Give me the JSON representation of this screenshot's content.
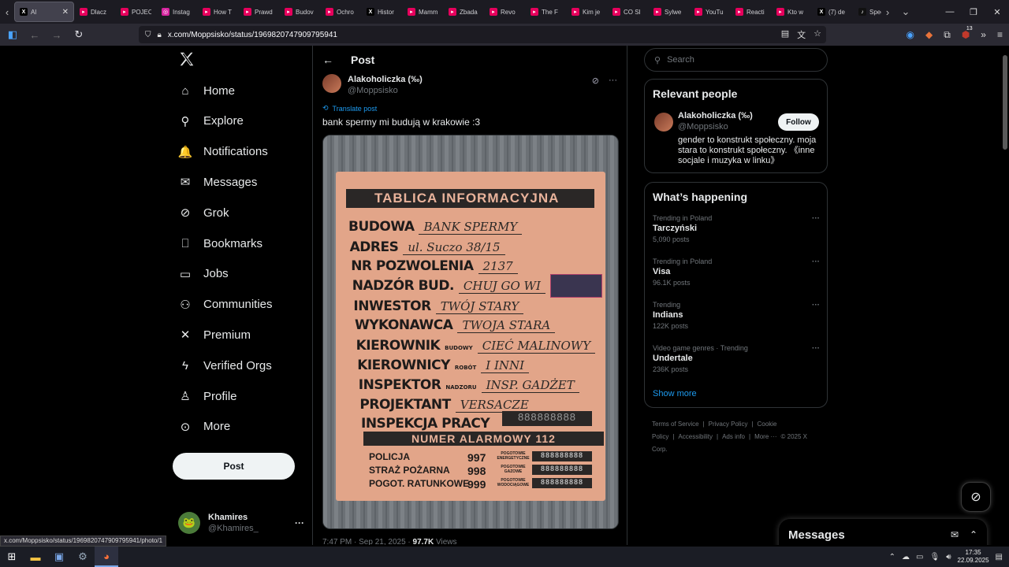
{
  "browser": {
    "tabs": [
      {
        "label": "Al",
        "color": "#000000",
        "glyph": "X",
        "active": true
      },
      {
        "label": "Dlacz",
        "color": "#e6005c",
        "glyph": "▸"
      },
      {
        "label": "POJEC",
        "color": "#e6005c",
        "glyph": "▸"
      },
      {
        "label": "Instag",
        "color": "#d6249f",
        "glyph": "◎"
      },
      {
        "label": "How T",
        "color": "#e6005c",
        "glyph": "▸"
      },
      {
        "label": "Prawd",
        "color": "#e6005c",
        "glyph": "▸"
      },
      {
        "label": "Budov",
        "color": "#e6005c",
        "glyph": "▸"
      },
      {
        "label": "Ochro",
        "color": "#e6005c",
        "glyph": "▸"
      },
      {
        "label": "Histor",
        "color": "#000000",
        "glyph": "X"
      },
      {
        "label": "Mamm",
        "color": "#e6005c",
        "glyph": "▸"
      },
      {
        "label": "Zbada",
        "color": "#e6005c",
        "glyph": "▸"
      },
      {
        "label": "Revo",
        "color": "#e6005c",
        "glyph": "▸"
      },
      {
        "label": "The F",
        "color": "#e6005c",
        "glyph": "▸"
      },
      {
        "label": "Kim je",
        "color": "#e6005c",
        "glyph": "▸"
      },
      {
        "label": "CO SI",
        "color": "#e6005c",
        "glyph": "▸"
      },
      {
        "label": "Sylwe",
        "color": "#e6005c",
        "glyph": "▸"
      },
      {
        "label": "YouTu",
        "color": "#e6005c",
        "glyph": "▸"
      },
      {
        "label": "Reacti",
        "color": "#e6005c",
        "glyph": "▸"
      },
      {
        "label": "Kto w",
        "color": "#e6005c",
        "glyph": "▸"
      },
      {
        "label": "(7) de",
        "color": "#000000",
        "glyph": "X"
      },
      {
        "label": "Spee",
        "color": "#111111",
        "glyph": "♪"
      }
    ],
    "url": "x.com/Moppsisko/status/1969820747909795941",
    "status_url": "x.com/Moppsisko/status/1969820747909795941/photo/1",
    "extension_badge": "13"
  },
  "nav": {
    "items": [
      {
        "label": "Home",
        "icon": "home-icon",
        "glyph": "⌂"
      },
      {
        "label": "Explore",
        "icon": "search-icon",
        "glyph": "⚲"
      },
      {
        "label": "Notifications",
        "icon": "bell-icon",
        "glyph": "🔔"
      },
      {
        "label": "Messages",
        "icon": "envelope-icon",
        "glyph": "✉"
      },
      {
        "label": "Grok",
        "icon": "grok-icon",
        "glyph": "⊘"
      },
      {
        "label": "Bookmarks",
        "icon": "bookmark-icon",
        "glyph": "⎕"
      },
      {
        "label": "Jobs",
        "icon": "briefcase-icon",
        "glyph": "▭"
      },
      {
        "label": "Communities",
        "icon": "people-icon",
        "glyph": "⚇"
      },
      {
        "label": "Premium",
        "icon": "x-icon",
        "glyph": "✕"
      },
      {
        "label": "Verified Orgs",
        "icon": "lightning-icon",
        "glyph": "ϟ"
      },
      {
        "label": "Profile",
        "icon": "person-icon",
        "glyph": "♙"
      },
      {
        "label": "More",
        "icon": "more-circle-icon",
        "glyph": "⊙"
      }
    ],
    "post_label": "Post",
    "account": {
      "name": "Khamires",
      "handle": "@Khamires_"
    }
  },
  "post": {
    "header_title": "Post",
    "author": {
      "name": "Alakoholiczka (‰)",
      "handle": "@Moppsisko"
    },
    "translate_label": "Translate post",
    "text": "bank spermy mi budują w krakowie :3",
    "meta": {
      "time": "7:47 PM · Sep 21, 2025 · ",
      "views_count": "97.7K",
      "views_label": " Views"
    },
    "sign": {
      "header": "TABLICA INFORMACYJNA",
      "rows": [
        {
          "label": "BUDOWA",
          "sub": "",
          "value": "BANK SPERMY"
        },
        {
          "label": "ADRES",
          "sub": "",
          "value": "ul. Suczo 38/15"
        },
        {
          "label": "NR POZWOLENIA",
          "sub": "",
          "value": "2137"
        },
        {
          "label": "NADZÓR BUD.",
          "sub": "",
          "value": "CHUJ GO WI"
        },
        {
          "label": "INWESTOR",
          "sub": "",
          "value": "TWÓJ STARY"
        },
        {
          "label": "WYKONAWCA",
          "sub": "",
          "value": "TWOJA STARA"
        },
        {
          "label": "KIEROWNIK",
          "sub": "BUDOWY",
          "value": "CIEĆ MALINOWY"
        },
        {
          "label": "KIEROWNICY",
          "sub": "ROBÓT",
          "value": "I INNI"
        },
        {
          "label": "INSPEKTOR",
          "sub": "NADZORU",
          "value": "INSP. GADŻET"
        },
        {
          "label": "PROJEKTANT",
          "sub": "",
          "value": "VERSACZE"
        },
        {
          "label": "INSPEKCJA PRACY",
          "sub": "",
          "value": ""
        }
      ],
      "inspekcja_digits": "888888888",
      "alarm": "NUMER ALARMOWY 112",
      "emergency": [
        {
          "label": "POLICJA",
          "number": "997",
          "service": "POGOTOWIE ENERGETYCZNE",
          "digits": "888888888"
        },
        {
          "label": "STRAŻ POŻARNA",
          "number": "998",
          "service": "POGOTOWIE GAZOWE",
          "digits": "888888888"
        },
        {
          "label": "POGOT. RATUNKOWE",
          "number": "999",
          "service": "POGOTOWIE WODOCIĄGOWE",
          "digits": "888888888"
        }
      ]
    }
  },
  "right": {
    "search_placeholder": "Search",
    "relevant": {
      "title": "Relevant people",
      "name": "Alakoholiczka (‰)",
      "handle": "@Moppsisko",
      "follow_label": "Follow",
      "bio": "gender to konstrukt społeczny. moja stara to konstrukt społeczny. 《inne socjale i muzyka w linku》"
    },
    "happening": {
      "title": "What’s happening",
      "trends": [
        {
          "context": "Trending in Poland",
          "name": "Tarczyński",
          "count": "5,090 posts"
        },
        {
          "context": "Trending in Poland",
          "name": "Visa",
          "count": "96.1K posts"
        },
        {
          "context": "Trending",
          "name": "Indians",
          "count": "122K posts"
        },
        {
          "context": "Video game genres · Trending",
          "name": "Undertale",
          "count": "236K posts"
        }
      ],
      "show_more": "Show more"
    },
    "footer": [
      "Terms of Service",
      "|",
      "Privacy Policy",
      "|",
      "Cookie Policy",
      "|",
      "Accessibility",
      "|",
      "Ads info",
      "|",
      "More ···",
      "© 2025 X Corp."
    ],
    "messages_title": "Messages"
  },
  "taskbar": {
    "time": "17:35",
    "date": "22.09.2025"
  }
}
